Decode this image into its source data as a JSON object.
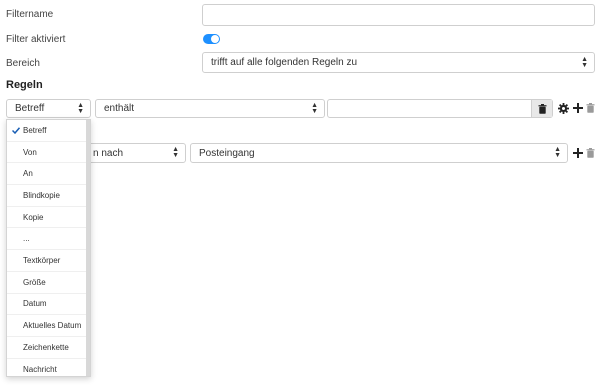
{
  "form": {
    "filtername_label": "Filtername",
    "filtername_value": "",
    "filter_active_label": "Filter aktiviert",
    "filter_active": true,
    "bereich_label": "Bereich",
    "bereich_value": "trifft auf alle folgenden Regeln zu"
  },
  "rules": {
    "title": "Regeln",
    "rule1": {
      "field": "Betreff",
      "operator": "enthält",
      "value": ""
    }
  },
  "actions": {
    "row1": {
      "action_partial": "n nach",
      "target": "Posteingang"
    }
  },
  "dropdown": {
    "selected": "Betreff",
    "items": [
      "Betreff",
      "Von",
      "An",
      "Blindkopie",
      "Kopie",
      "...",
      "Textkörper",
      "Größe",
      "Datum",
      "Aktuelles Datum",
      "Zeichenkette",
      "Nachricht"
    ]
  },
  "icons": {
    "toggle": "toggle-on-icon",
    "trash": "trash-icon",
    "settings": "gear-icon",
    "add": "plus-icon",
    "check": "check-icon"
  },
  "colors": {
    "accent": "#1e90ff",
    "text": "#333333",
    "border": "#cfcfcf"
  }
}
